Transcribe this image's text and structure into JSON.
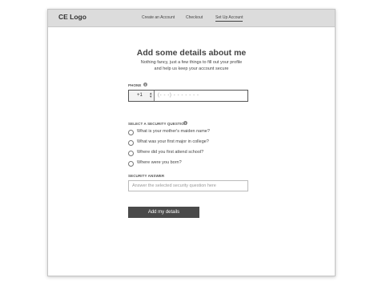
{
  "header": {
    "logo": "CE Logo",
    "nav": [
      {
        "label": "Create an Account"
      },
      {
        "label": "Checkout"
      },
      {
        "label": "Set Up Account",
        "active": true
      }
    ]
  },
  "main": {
    "heading": "Add some details about me",
    "subtitle_line1": "Nothing fancy, just a few things to fill out your profile",
    "subtitle_line2": "and help us keep your account secure"
  },
  "phone": {
    "label": "PHONE",
    "country_code": "+1",
    "input_placeholder": "(- - -) - - - - - - -"
  },
  "security_question": {
    "label": "SELECT A SECURITY QUESTION",
    "options": [
      "What is your mother's maiden name?",
      "What was your first major in college?",
      "Where did you first attend school?",
      "Where were you born?"
    ]
  },
  "security_answer": {
    "label": "SECURITY ANSWER",
    "placeholder": "Answer the selected security question here"
  },
  "submit_label": "Add my details",
  "icons": {
    "info": "info-icon",
    "stepper": "stepper-icon",
    "radio": "radio-unchecked-icon"
  },
  "colors": {
    "topbar": "#dcdcdc",
    "button": "#4a4a4a"
  }
}
